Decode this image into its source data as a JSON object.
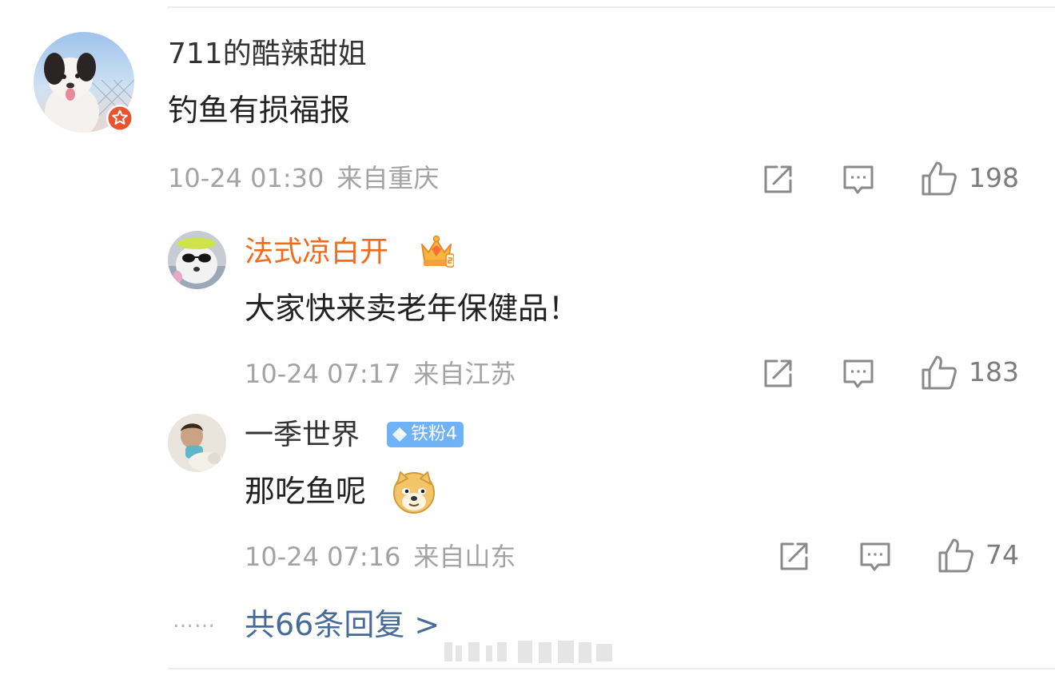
{
  "comment": {
    "username": "711的酷辣甜姐",
    "text": "钓鱼有损福报",
    "date": "10-24 01:30",
    "location": "来自重庆",
    "like_count": "198"
  },
  "replies": [
    {
      "username": "法式凉白开",
      "text": "大家快来卖老年保健品！",
      "date": "10-24 07:17",
      "location": "来自江苏",
      "like_count": "183",
      "name_color": "#f06b1a"
    },
    {
      "username": "一季世界",
      "badge": "铁粉4",
      "text": "那吃鱼呢",
      "date": "10-24 07:16",
      "location": "来自山东",
      "like_count": "74",
      "name_color": "#333333"
    }
  ],
  "more": {
    "dots": "……",
    "label": "共66条回复 >"
  },
  "icons": {
    "share": "share-icon",
    "comment": "comment-icon",
    "like": "thumbs-up-icon",
    "verified": "verified-badge-icon",
    "vip": "vip-crown-icon",
    "emoji": "doge-emoji-icon"
  },
  "colors": {
    "meta": "#a3a3a3",
    "link": "#466b98",
    "badge": "#6fb2f5"
  }
}
